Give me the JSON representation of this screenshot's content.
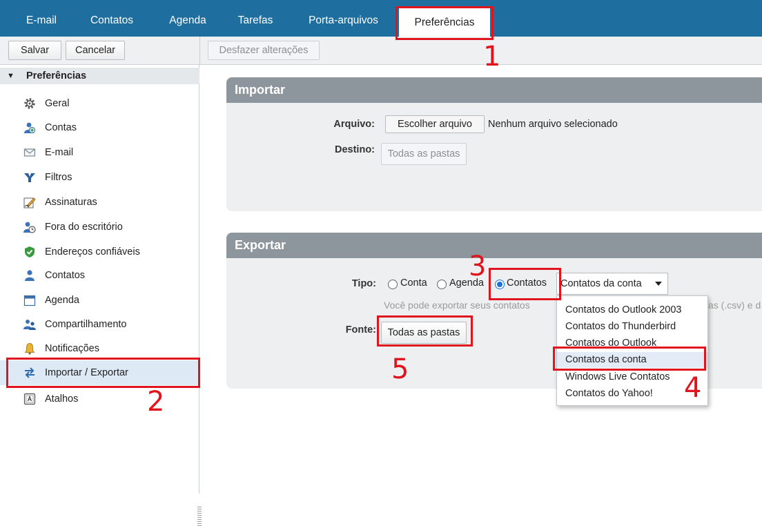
{
  "tabs": [
    {
      "label": "E-mail"
    },
    {
      "label": "Contatos"
    },
    {
      "label": "Agenda"
    },
    {
      "label": "Tarefas"
    },
    {
      "label": "Porta-arquivos"
    },
    {
      "label": "Preferências",
      "active": true
    }
  ],
  "toolbar": {
    "save_label": "Salvar",
    "cancel_label": "Cancelar",
    "undo_label": "Desfazer alterações"
  },
  "sidebar": {
    "header": "Preferências",
    "items": [
      {
        "label": "Geral",
        "icon": "gear-icon"
      },
      {
        "label": "Contas",
        "icon": "accounts-icon"
      },
      {
        "label": "E-mail",
        "icon": "envelope-icon"
      },
      {
        "label": "Filtros",
        "icon": "filter-icon"
      },
      {
        "label": "Assinaturas",
        "icon": "signature-icon"
      },
      {
        "label": "Fora do escritório",
        "icon": "out-of-office-icon"
      },
      {
        "label": "Endereços confiáveis",
        "icon": "shield-check-icon"
      },
      {
        "label": "Contatos",
        "icon": "contact-icon"
      },
      {
        "label": "Agenda",
        "icon": "calendar-icon"
      },
      {
        "label": "Compartilhamento",
        "icon": "sharing-icon"
      },
      {
        "label": "Notificações",
        "icon": "bell-icon"
      },
      {
        "label": "Importar / Exportar",
        "icon": "import-export-icon",
        "selected": true
      },
      {
        "label": "Atalhos",
        "icon": "keyboard-icon"
      }
    ]
  },
  "import": {
    "title": "Importar",
    "file_label": "Arquivo:",
    "choose_file_label": "Escolher arquivo",
    "no_file_text": "Nenhum arquivo selecionado",
    "destination_label": "Destino:",
    "destination_value": "Todas as pastas"
  },
  "export": {
    "title": "Exportar",
    "type_label": "Tipo:",
    "radio_account": "Conta",
    "radio_calendar": "Agenda",
    "radio_contacts": "Contatos",
    "selected_radio": "Contatos",
    "format_selected": "Contatos da conta",
    "hint_left": "Você pode exportar seus contatos",
    "hint_right": "as (.csv) e d",
    "source_label": "Fonte:",
    "source_value": "Todas as pastas"
  },
  "dropdown": {
    "options": [
      "Contatos do Outlook 2003",
      "Contatos do Thunderbird",
      "Contatos do Outlook",
      "Contatos da conta",
      "Windows Live Contatos",
      "Contatos do Yahoo!"
    ],
    "highlighted": "Contatos da conta"
  },
  "annotations": [
    "1",
    "2",
    "3",
    "4",
    "5"
  ],
  "colors": {
    "topbar": "#1e6e9f",
    "panel_header": "#8e969d",
    "annotation": "#e0141c",
    "radio_selected": "#1b72d8"
  }
}
